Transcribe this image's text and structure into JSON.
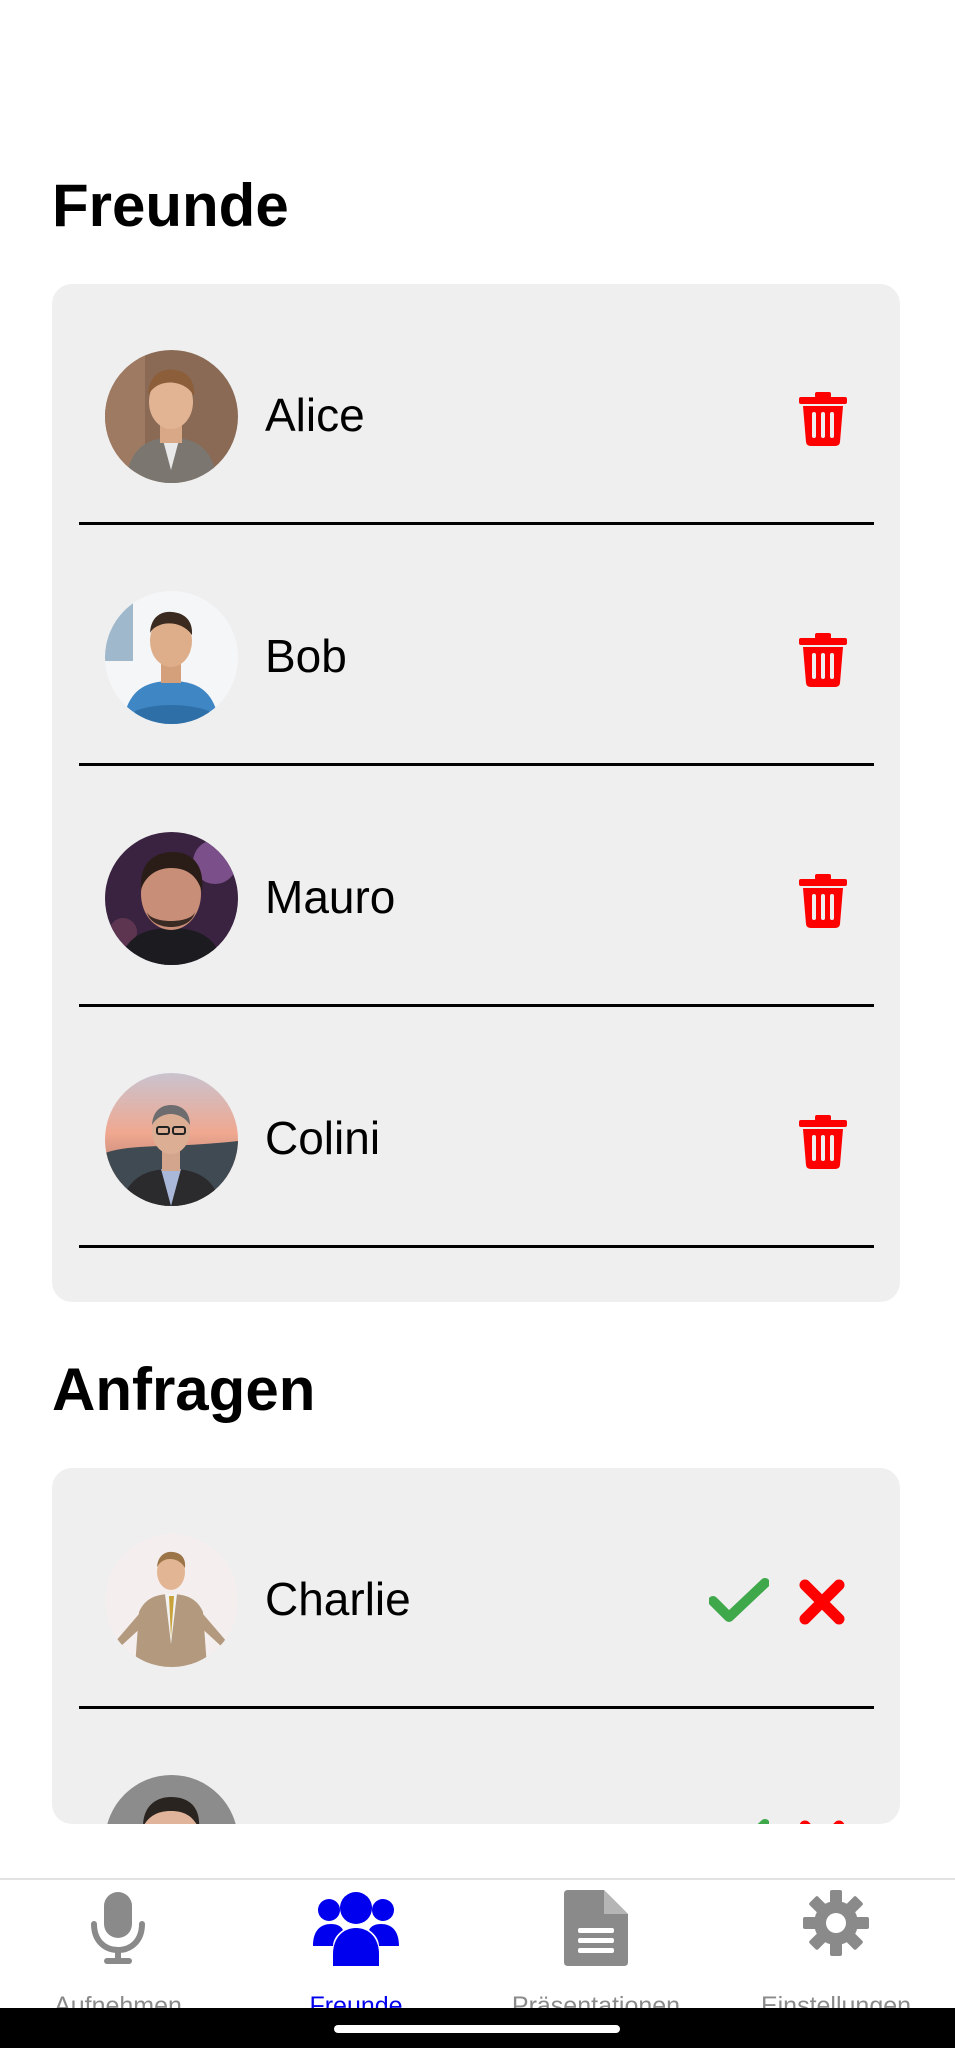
{
  "friends_section": {
    "title": "Freunde",
    "items": [
      {
        "name": "Alice"
      },
      {
        "name": "Bob"
      },
      {
        "name": "Mauro"
      },
      {
        "name": "Colini"
      }
    ]
  },
  "requests_section": {
    "title": "Anfragen",
    "items": [
      {
        "name": "Charlie"
      },
      {
        "name": ""
      }
    ]
  },
  "bottom_nav": {
    "items": [
      {
        "label": "Aufnehmen",
        "icon": "microphone-icon",
        "active": false
      },
      {
        "label": "Freunde",
        "icon": "users-icon",
        "active": true
      },
      {
        "label": "Präsentationen",
        "icon": "document-icon",
        "active": false
      },
      {
        "label": "Einstellungen",
        "icon": "gear-icon",
        "active": false
      }
    ]
  },
  "colors": {
    "delete": "#ff0000",
    "accept": "#3ea84a",
    "decline": "#ff0000",
    "nav_active": "#0000ee",
    "nav_inactive": "#8a8a8a",
    "card_background": "#efefef"
  }
}
